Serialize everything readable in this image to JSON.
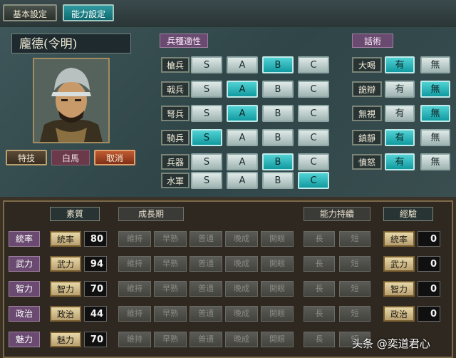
{
  "tabs": [
    {
      "label": "基本設定",
      "active": false
    },
    {
      "label": "能力設定",
      "active": true
    }
  ],
  "general": {
    "name": "龐德(令明)",
    "skill_label": "特技",
    "skill_value": "白馬",
    "cancel_label": "取消"
  },
  "troop_aptitude": {
    "title": "兵種適性",
    "grades": [
      "S",
      "A",
      "B",
      "C"
    ],
    "rows": [
      {
        "label": "槍兵",
        "selected": "B"
      },
      {
        "label": "戟兵",
        "selected": "A"
      },
      {
        "label": "弩兵",
        "selected": "A"
      },
      {
        "label": "騎兵",
        "selected": "S"
      },
      {
        "label": "兵器",
        "selected": "B"
      },
      {
        "label": "水軍",
        "selected": "C"
      }
    ]
  },
  "speech": {
    "title": "話術",
    "options": [
      "有",
      "無"
    ],
    "rows": [
      {
        "label": "大喝",
        "selected": "有"
      },
      {
        "label": "詭辯",
        "selected": "無"
      },
      {
        "label": "無視",
        "selected": "無"
      },
      {
        "label": "鎮靜",
        "selected": "有"
      },
      {
        "label": "憤怒",
        "selected": "有"
      }
    ]
  },
  "stats": {
    "headers": {
      "quality": "素質",
      "growth": "成長期",
      "persistence": "能力持續",
      "experience": "經驗"
    },
    "growth_options": [
      "維持",
      "早熟",
      "普通",
      "晚成",
      "開眼"
    ],
    "persistence_options": [
      "長",
      "短"
    ],
    "rows": [
      {
        "label": "統率",
        "value": "80",
        "exp": "0"
      },
      {
        "label": "武力",
        "value": "94",
        "exp": "0"
      },
      {
        "label": "智力",
        "value": "70",
        "exp": "0"
      },
      {
        "label": "政治",
        "value": "44",
        "exp": "0"
      },
      {
        "label": "魅力",
        "value": "70",
        "exp": "0"
      }
    ]
  },
  "watermark": "头条 @奕道君心",
  "colors": {
    "accent_on": "#1aa6ac",
    "panel": "#2f4547",
    "section_label": "#6a4a70"
  }
}
